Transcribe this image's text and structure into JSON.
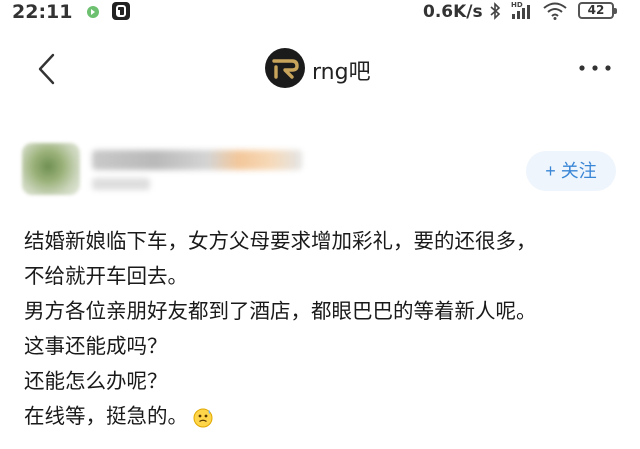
{
  "status_bar": {
    "time": "22:11",
    "network_speed": "0.6K/s",
    "battery": "42",
    "icons": [
      "app-notification-icon",
      "app-notification-icon-2",
      "bluetooth-icon",
      "hd-signal-icon",
      "wifi-icon",
      "battery-icon"
    ]
  },
  "nav": {
    "back_icon": "chevron-left-icon",
    "forum_name": "rng吧",
    "more_icon": "more-dots-icon"
  },
  "author": {
    "follow_label": "+ 关注"
  },
  "post": {
    "lines": [
      "结婚新娘临下车，女方父母要求增加彩礼，要的还很多，",
      "不给就开车回去。",
      "男方各位亲朋好友都到了酒店，都眼巴巴的等着新人呢。",
      "这事还能成吗？",
      "还能怎么办呢？",
      "在线等，挺急的。"
    ],
    "trailing_emoji": "nervous-face-emoji-icon"
  },
  "colors": {
    "accent": "#3a86d6",
    "follow_bg": "#eef5fc",
    "text": "#1a1a1a"
  }
}
